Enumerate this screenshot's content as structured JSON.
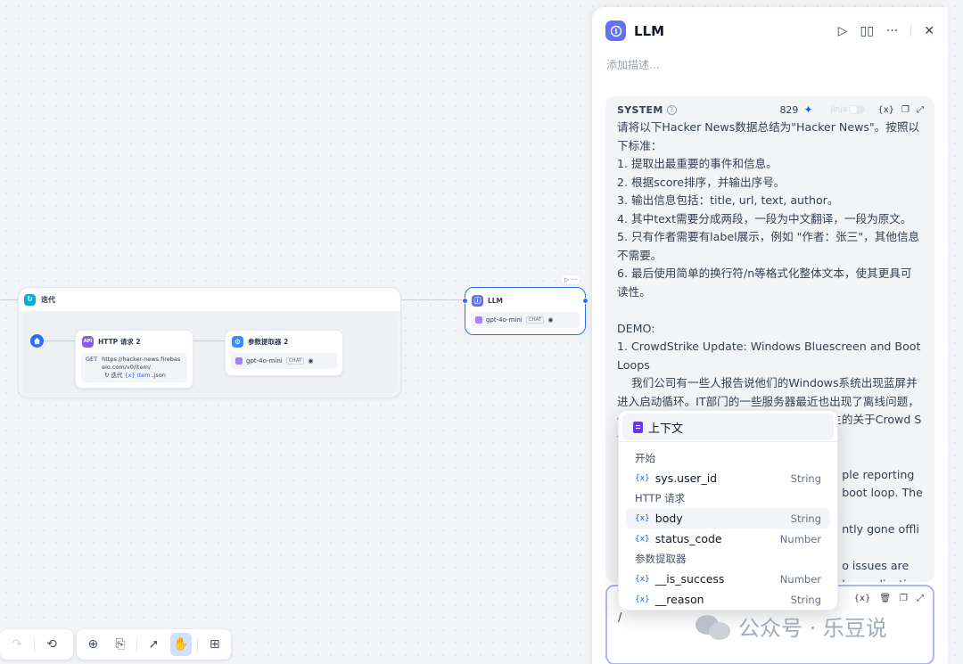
{
  "canvas": {
    "iteration": {
      "title": "迭代",
      "ghost_text": ""
    },
    "http_node": {
      "title": "HTTP 请求 2",
      "method": "GET",
      "url": "https://hacker-news.firebaseio.com/v0/item/",
      "var_prefix": "迭代",
      "var_name": "{x} item",
      "suffix": ".json"
    },
    "param_node": {
      "title": "参数提取器 2",
      "model": "gpt-4o-mini",
      "mode": "CHAT"
    },
    "llm_node": {
      "title": "LLM",
      "model": "gpt-4o-mini",
      "mode": "CHAT"
    }
  },
  "panel": {
    "title": "LLM",
    "description_placeholder": "添加描述...",
    "system": {
      "label": "SYSTEM",
      "count": "829",
      "jinja": "Jinja",
      "text": "请将以下Hacker News数据总结为\"Hacker News\"。按照以下标准：\n1. 提取出最重要的事件和信息。\n2. 根据score排序，并输出序号。\n3. 输出信息包括：title, url, text, author。\n4. 其中text需要分成两段，一段为中文翻译，一段为原文。\n5. 只有作者需要有label展示，例如 \"作者：张三\"，其他信息不需要。\n6. 最后使用简单的换行符/n等格式化整体文本，使其更具可读性。\n\nDEMO:\n1. CrowdStrike Update: Windows Bluescreen and Boot Loops\n    我们公司有一些人报告说他们的Windows系统出现蓝屏并进入启动循环。IT部门的一些服务器最近也出现了离线问题，他们正在调查中。有人推测这可能与即将发生的关于Crowd Strike\n\n                                                               ple reporting\n                                                               boot loop. The IT\n                                                               ntly gone offline\n                                                               o issues are\n                                                               ke application"
    },
    "user_input": "/"
  },
  "dropdown": {
    "context_label": "上下文",
    "groups": [
      {
        "name": "开始",
        "items": [
          {
            "name": "sys.user_id",
            "type": "String"
          }
        ]
      },
      {
        "name": "HTTP 请求",
        "items": [
          {
            "name": "body",
            "type": "String"
          },
          {
            "name": "status_code",
            "type": "Number"
          }
        ]
      },
      {
        "name": "参数提取器",
        "items": [
          {
            "name": "__is_success",
            "type": "Number"
          },
          {
            "name": "__reason",
            "type": "String"
          }
        ]
      }
    ]
  },
  "watermark": {
    "text": "公众号 · 乐豆说"
  },
  "colors": {
    "accent": "#296dff",
    "llm_icon": "#6172f3",
    "selection_border": "#a9b8f9"
  }
}
